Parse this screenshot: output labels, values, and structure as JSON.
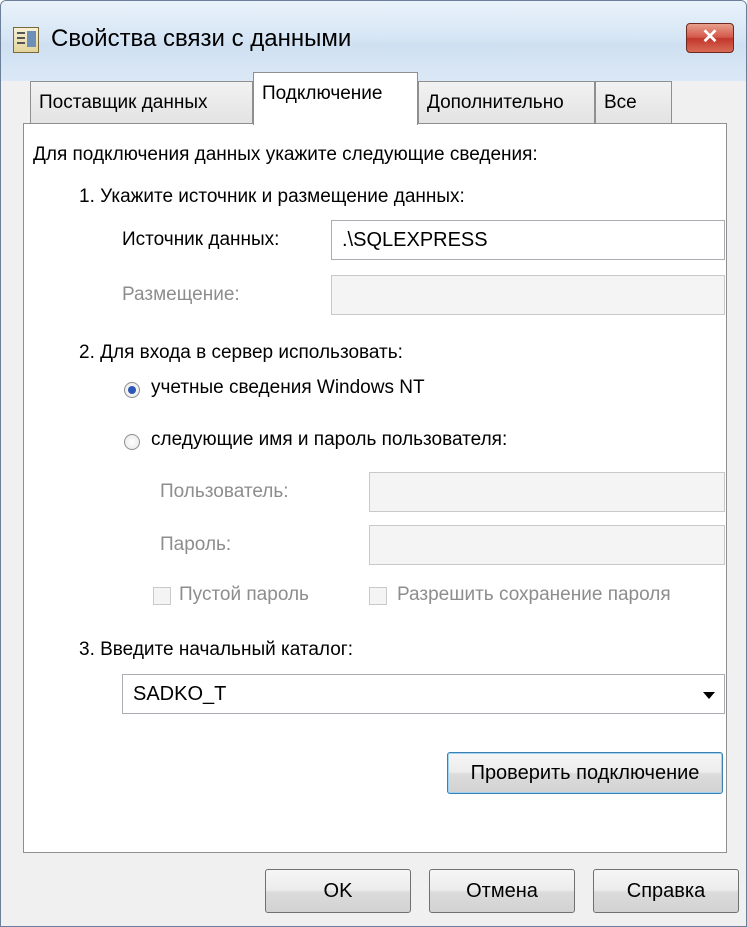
{
  "window": {
    "title": "Свойства связи с данными",
    "close_label": "✕"
  },
  "tabs": [
    {
      "label": "Поставщик данных",
      "active": false
    },
    {
      "label": "Подключение",
      "active": true
    },
    {
      "label": "Дополнительно",
      "active": false
    },
    {
      "label": "Все",
      "active": false
    }
  ],
  "connection": {
    "intro": "Для подключения данных укажите следующие сведения:",
    "step1": "1. Укажите источник и размещение данных:",
    "source_label": "Источник данных:",
    "source_value": ".\\SQLEXPRESS",
    "location_label": "Размещение:",
    "location_value": "",
    "step2": "2. Для входа в сервер использовать:",
    "radio_windows": "учетные сведения Windows NT",
    "radio_user": "следующие имя и пароль пользователя:",
    "user_label": "Пользователь:",
    "user_value": "",
    "password_label": "Пароль:",
    "password_value": "",
    "blank_password": "Пустой пароль",
    "save_password": "Разрешить сохранение пароля",
    "step3": "3. Введите начальный каталог:",
    "catalog_value": "SADKO_T",
    "test_button": "Проверить подключение"
  },
  "footer": {
    "ok": "OK",
    "cancel": "Отмена",
    "help": "Справка"
  }
}
